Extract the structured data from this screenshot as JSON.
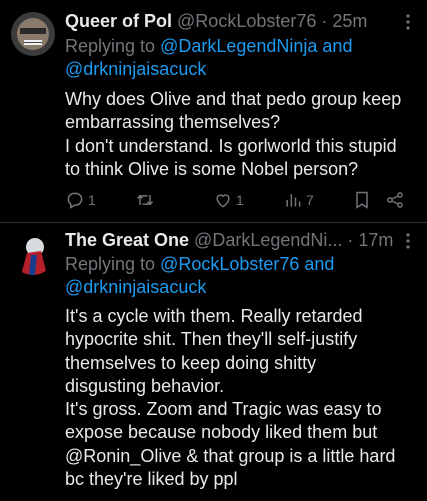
{
  "tweets": [
    {
      "name": "Queer of Pol",
      "handle_time": "@RockLobster76 · 25m",
      "reply_prefix": "Replying to ",
      "reply_mention1": "@DarkLegendNinja",
      "reply_and": " and",
      "reply_mention2": "@drkninjaisacuck",
      "lines": [
        "Why does Olive and that pedo group keep",
        "embarrassing themselves?",
        "I don't understand. Is gorlworld this stupid",
        "to think Olive is some Nobel person?"
      ],
      "reply_count": "1",
      "like_count": "1",
      "view_count": "7"
    },
    {
      "name": "The Great One",
      "handle_time": "@DarkLegendNi... · 17m",
      "reply_prefix": "Replying to ",
      "reply_mention1": "@RockLobster76",
      "reply_and": " and",
      "reply_mention2": "@drkninjaisacuck",
      "lines": [
        "It's a cycle with them. Really retarded",
        "hypocrite shit. Then they'll self-justify",
        "themselves to keep doing shitty",
        "disgusting behavior.",
        "It's gross. Zoom and Tragic was easy to",
        "expose because nobody liked them but",
        "@Ronin_Olive & that group is a little hard",
        "bc they're liked by ppl"
      ]
    }
  ],
  "colors": {
    "background": "#000000",
    "text": "#e7e9ea",
    "muted": "#71767b",
    "link": "#1d9bf0"
  },
  "icons": [
    "reply-icon",
    "retweet-icon",
    "like-icon",
    "views-icon",
    "bookmark-icon",
    "share-icon",
    "more-icon"
  ]
}
